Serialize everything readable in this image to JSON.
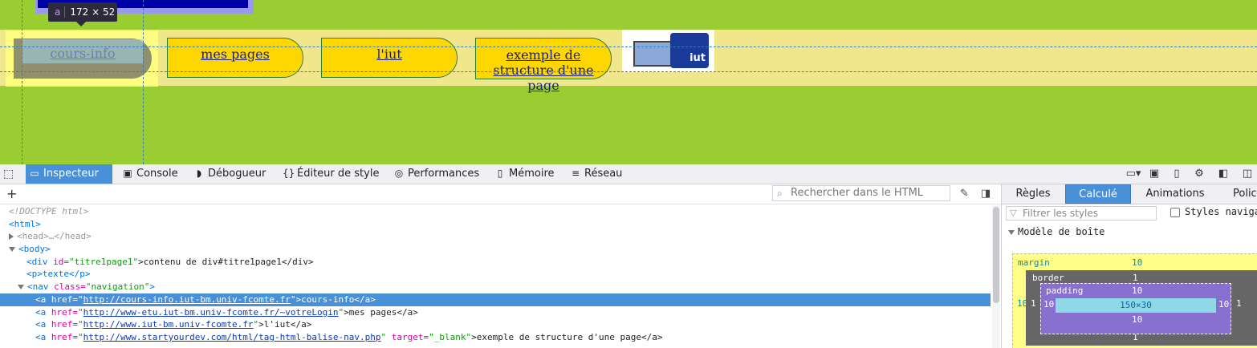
{
  "tooltip": {
    "tag": "a",
    "dims": "172 × 52"
  },
  "nav_links": [
    "cours-info",
    "mes pages",
    "l'iut",
    "exemple de structure d'une page"
  ],
  "iut_badge": "iut",
  "colors": {
    "page_bg": "#9acd32",
    "nav_band": "#f0e68c",
    "link_bg": "#ffd700",
    "highlight": "#ffff80",
    "devtools_accent": "#4a90d9"
  },
  "devtools": {
    "tabs": [
      {
        "label": "Inspecteur",
        "icon": "inspector-icon"
      },
      {
        "label": "Console",
        "icon": "console-icon"
      },
      {
        "label": "Débogueur",
        "icon": "debugger-icon"
      },
      {
        "label": "Éditeur de style",
        "icon": "style-editor-icon"
      },
      {
        "label": "Performances",
        "icon": "performance-icon"
      },
      {
        "label": "Mémoire",
        "icon": "memory-icon"
      },
      {
        "label": "Réseau",
        "icon": "network-icon"
      }
    ],
    "search_placeholder": "Rechercher dans le HTML",
    "code": {
      "doctype": "<!DOCTYPE html>",
      "html_open": "<html>",
      "head": "<head>",
      "head_close": "</head>",
      "head_ellipsis": "…",
      "body_open": "<body>",
      "div_tag": "<div",
      "div_attr": "id=",
      "div_val": "\"titre1page1\"",
      "div_text": ">contenu de div#titre1page1</div>",
      "p_line": "<p>texte</p>",
      "nav_tag": "<nav",
      "nav_attr": "class=",
      "nav_val": "\"navigation\"",
      "nav_end": ">",
      "links": [
        {
          "href": "http://cours-info.iut-bm.univ-fcomte.fr",
          "text": ">cours-info</a>"
        },
        {
          "href": "http://www-etu.iut-bm.univ-fcomte.fr/~votreLogin",
          "text": ">mes pages</a>"
        },
        {
          "href": "http://www.iut-bm.univ-fcomte.fr",
          "text": ">l'iut</a>"
        },
        {
          "href": "http://www.startyourdev.com/html/tag-html-balise-nav.php",
          "target_attr": "target=",
          "target_val": "\"_blank\"",
          "text": ">exemple de structure d'une page</a>"
        }
      ],
      "a_tag": "<a",
      "href_attr": "href=",
      "quote": "\""
    },
    "side_tabs": [
      "Règles",
      "Calculé",
      "Animations",
      "Polices"
    ],
    "filter_placeholder": "Filtrer les styles",
    "browser_styles": "Styles navigateur",
    "box_model_title": "Modèle de boîte",
    "box": {
      "margin_label": "margin",
      "margin": "10",
      "border_label": "border",
      "border": "1",
      "padding_label": "padding",
      "padding": "10",
      "content": "150×30"
    }
  }
}
